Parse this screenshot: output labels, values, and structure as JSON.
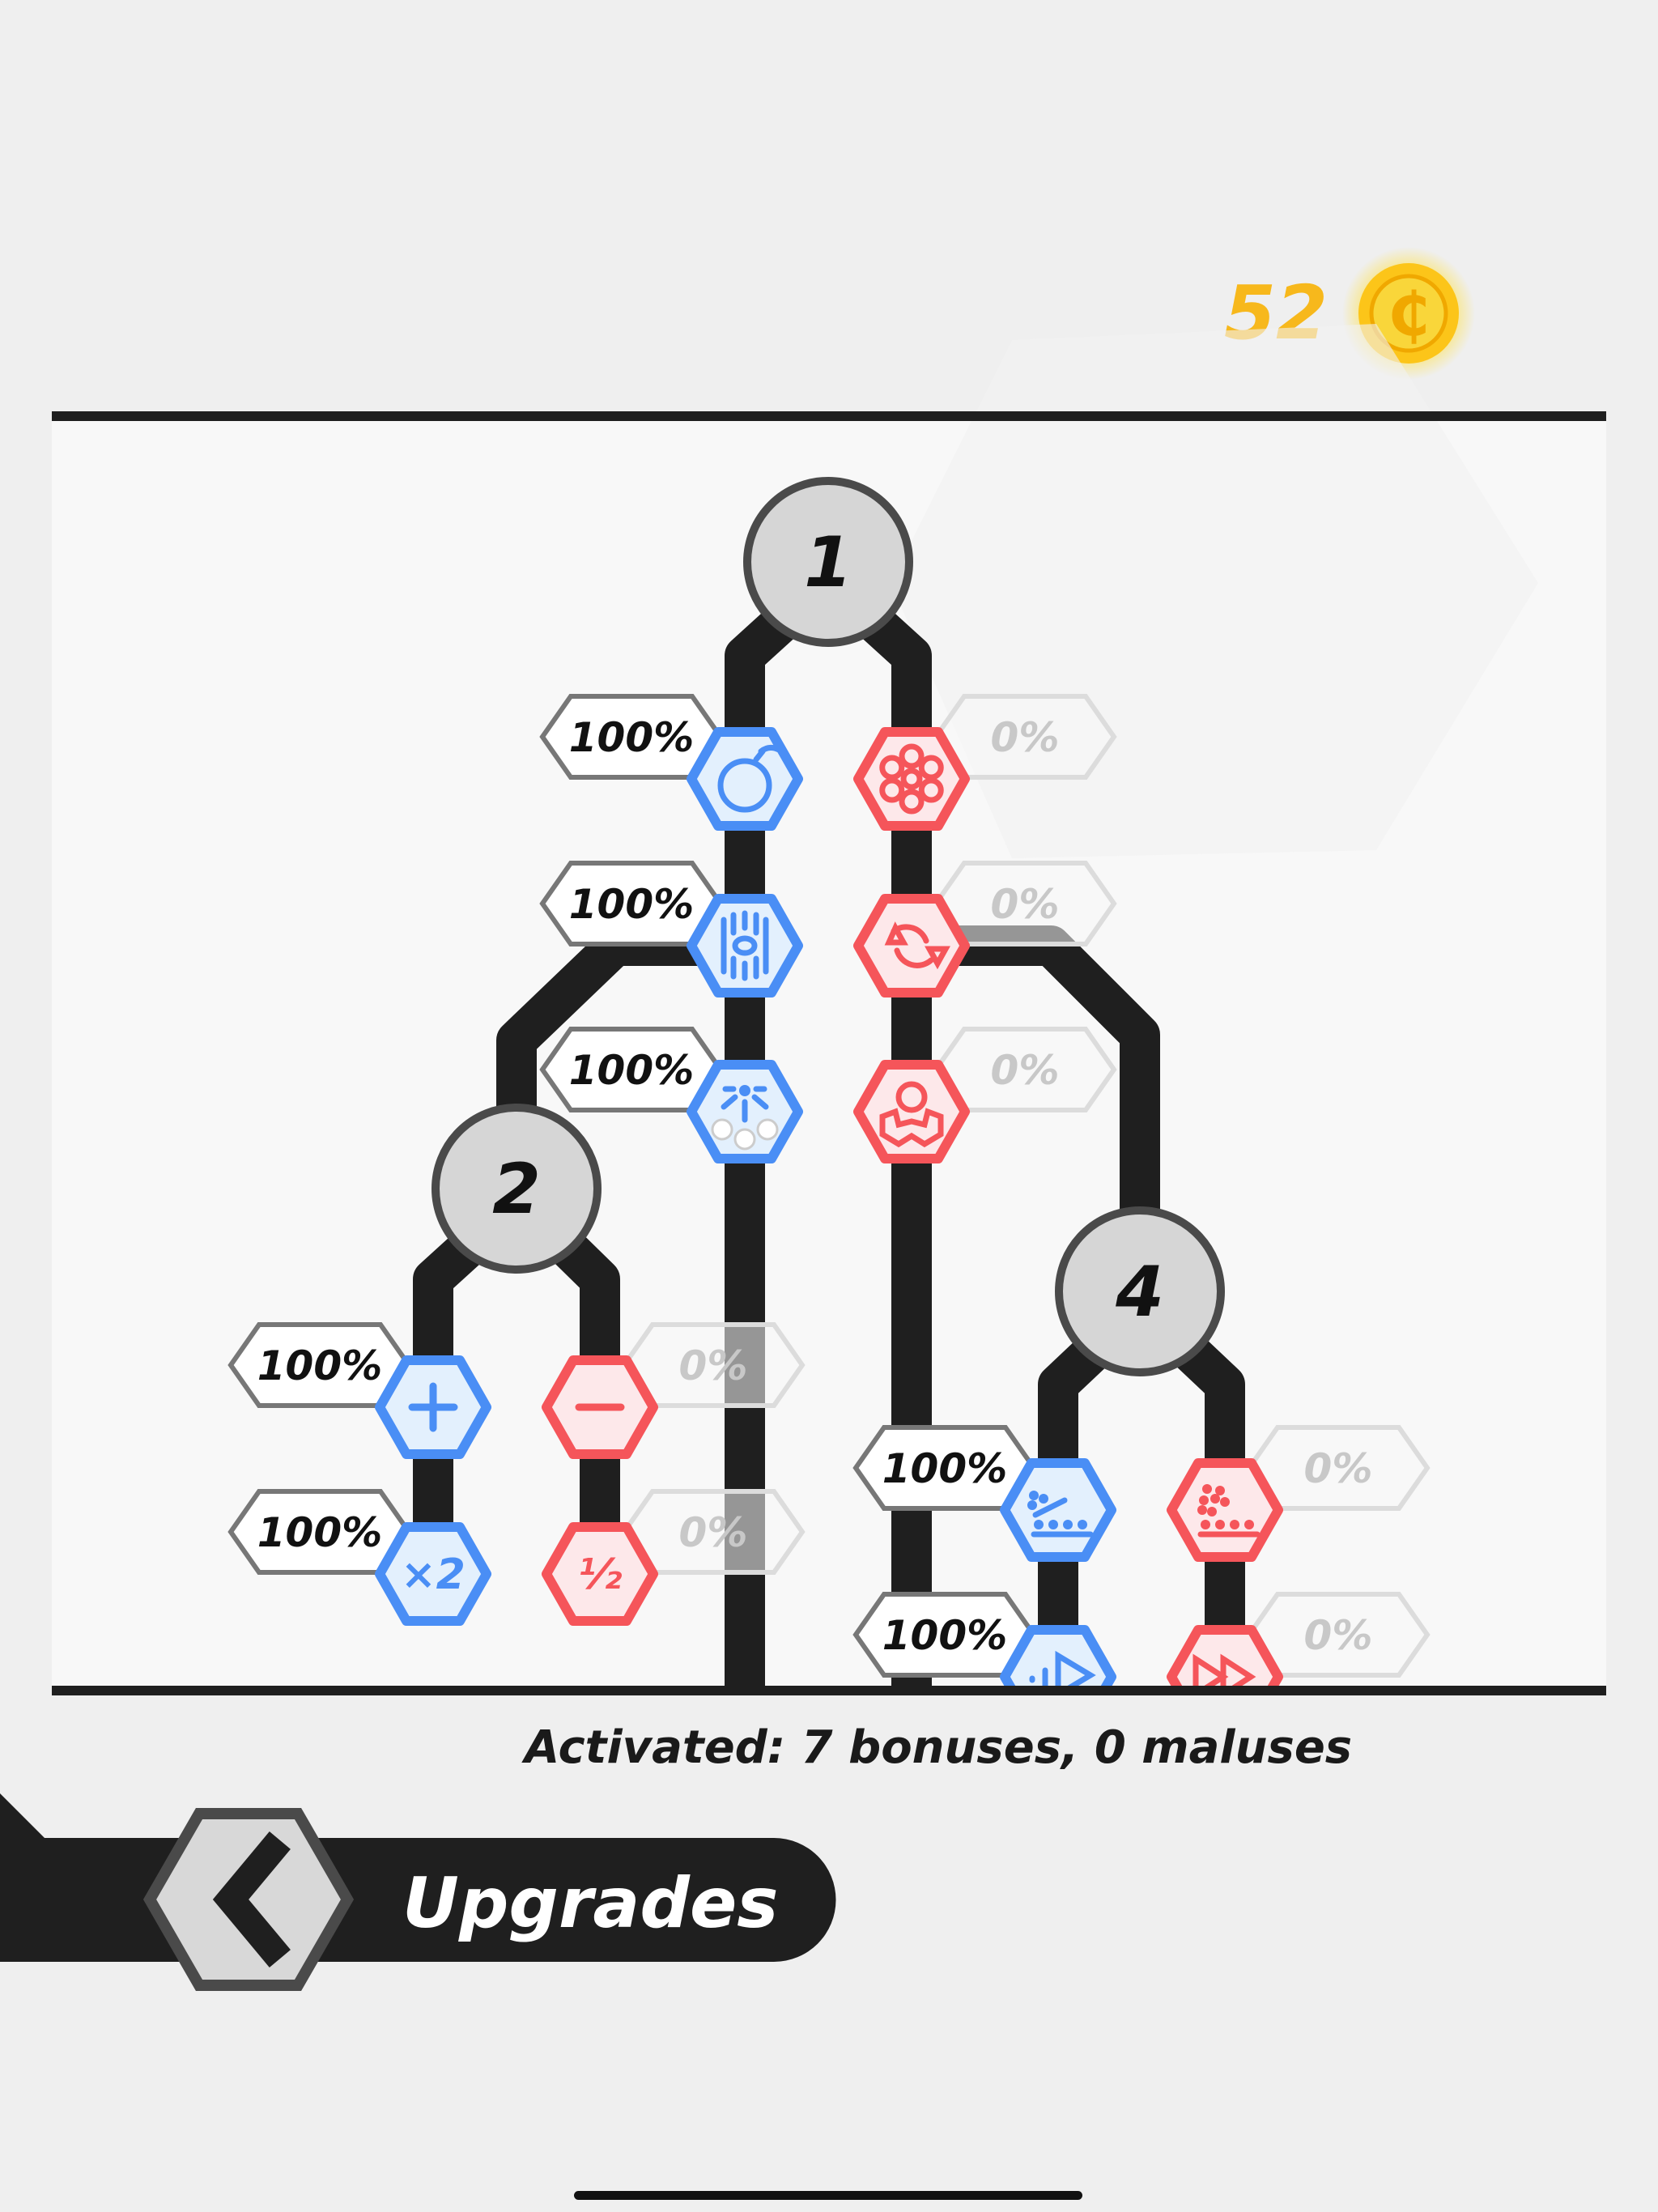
{
  "header": {
    "coins": "52",
    "coin_icon": "coin-icon"
  },
  "colors": {
    "bonus_stroke": "#4a8ef5",
    "bonus_fill": "#e3f0fd",
    "malus_stroke": "#f5555a",
    "malus_fill": "#fde8ea",
    "track": "#1f1f1f",
    "coin": "#f7b81c"
  },
  "tree": {
    "hubs": [
      {
        "id": "1",
        "label": "1"
      },
      {
        "id": "2",
        "label": "2"
      },
      {
        "id": "4",
        "label": "4"
      }
    ],
    "nodes": [
      {
        "slot": "a1",
        "type": "bonus",
        "icon": "bomb",
        "percent": "100%"
      },
      {
        "slot": "a2",
        "type": "bonus",
        "icon": "laser",
        "percent": "100%"
      },
      {
        "slot": "a3",
        "type": "bonus",
        "icon": "explosion",
        "percent": "100%"
      },
      {
        "slot": "b1",
        "type": "malus",
        "icon": "flower",
        "percent": "0%"
      },
      {
        "slot": "b2",
        "type": "malus",
        "icon": "cycle",
        "percent": "0%"
      },
      {
        "slot": "b3",
        "type": "malus",
        "icon": "person",
        "percent": "0%"
      },
      {
        "slot": "c1",
        "type": "bonus",
        "icon": "plus",
        "percent": "100%"
      },
      {
        "slot": "c2",
        "type": "bonus",
        "icon": "x2",
        "icon_text": "×2",
        "percent": "100%"
      },
      {
        "slot": "d1",
        "type": "malus",
        "icon": "minus",
        "percent": "0%"
      },
      {
        "slot": "d2",
        "type": "malus",
        "icon": "half",
        "icon_text": "½",
        "percent": "0%"
      },
      {
        "slot": "e1",
        "type": "bonus",
        "icon": "balls-slope",
        "percent": "100%"
      },
      {
        "slot": "e2",
        "type": "bonus",
        "icon": "play",
        "percent": "100%"
      },
      {
        "slot": "f1",
        "type": "malus",
        "icon": "balls-pile",
        "percent": "0%"
      },
      {
        "slot": "f2",
        "type": "malus",
        "icon": "fast-forward",
        "percent": "0%"
      }
    ]
  },
  "status": {
    "activated": "Activated: 7 bonuses, 0 maluses"
  },
  "footer": {
    "title": "Upgrades",
    "back_icon": "chevron-left-icon"
  }
}
